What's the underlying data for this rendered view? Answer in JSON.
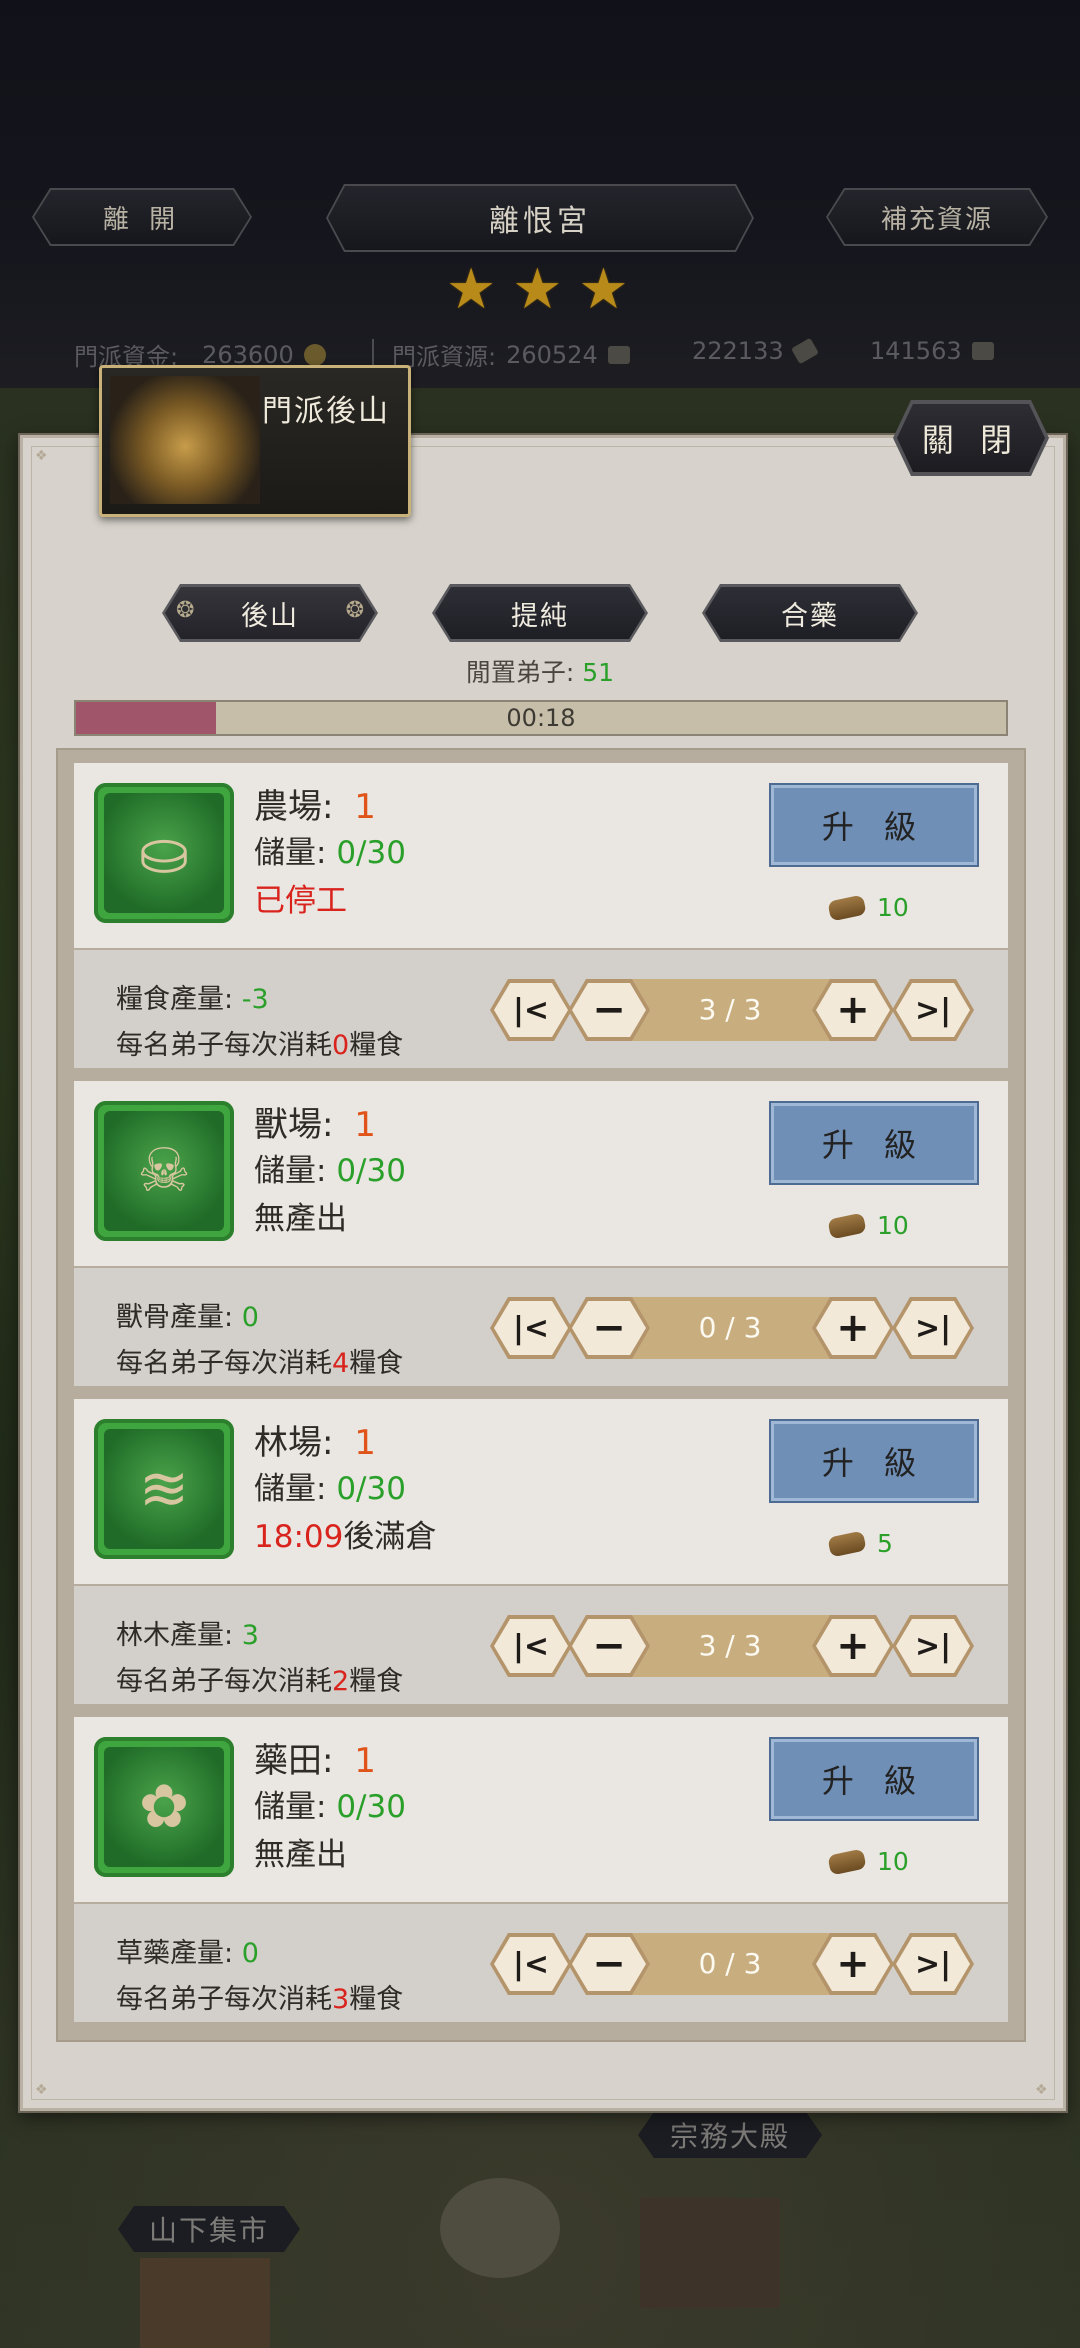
{
  "topbar": {
    "leave_label": "離 開",
    "sect_name": "離恨宮",
    "refill_label": "補充資源",
    "stars": [
      "★",
      "★",
      "★"
    ],
    "funds_label": "門派資金:",
    "funds_value": "263600",
    "resources_label": "門派資源:",
    "resources_value": "260524",
    "res2_value": "222133",
    "res3_value": "141563"
  },
  "panel": {
    "title": "門派後山",
    "close_label": "關 閉",
    "tabs": [
      {
        "label": "後山",
        "active": true
      },
      {
        "label": "提純",
        "active": false
      },
      {
        "label": "合藥",
        "active": false
      }
    ],
    "idle_label": "閒置弟子:",
    "idle_value": "51",
    "timer": "00:18",
    "timer_progress": 0.15,
    "buildings": [
      {
        "name": "農場:",
        "level": "1",
        "storage_label": "儲量:",
        "storage_value": "0/30",
        "status": "已停工",
        "status_time": "",
        "status_suffix": "",
        "upgrade_label": "升 級",
        "cost": "10",
        "prod_label": "糧食產量:",
        "prod_value": "-3",
        "consume_prefix": "每名弟子每次消耗",
        "consume_value": "0",
        "consume_suffix": "糧食",
        "workers": "3 / 3",
        "icon": "grain-sacks-icon"
      },
      {
        "name": "獸場:",
        "level": "1",
        "storage_label": "儲量:",
        "storage_value": "0/30",
        "status": "無產出",
        "status_time": "",
        "status_suffix": "",
        "upgrade_label": "升 級",
        "cost": "10",
        "prod_label": "獸骨產量:",
        "prod_value": "0",
        "consume_prefix": "每名弟子每次消耗",
        "consume_value": "4",
        "consume_suffix": "糧食",
        "workers": "0 / 3",
        "icon": "beast-skull-icon"
      },
      {
        "name": "林場:",
        "level": "1",
        "storage_label": "儲量:",
        "storage_value": "0/30",
        "status": "",
        "status_time": "18:09",
        "status_suffix": "後滿倉",
        "upgrade_label": "升 級",
        "cost": "5",
        "prod_label": "林木產量:",
        "prod_value": "3",
        "consume_prefix": "每名弟子每次消耗",
        "consume_value": "2",
        "consume_suffix": "糧食",
        "workers": "3 / 3",
        "icon": "log-pile-icon"
      },
      {
        "name": "藥田:",
        "level": "1",
        "storage_label": "儲量:",
        "storage_value": "0/30",
        "status": "無產出",
        "status_time": "",
        "status_suffix": "",
        "upgrade_label": "升 級",
        "cost": "10",
        "prod_label": "草藥產量:",
        "prod_value": "0",
        "consume_prefix": "每名弟子每次消耗",
        "consume_value": "3",
        "consume_suffix": "糧食",
        "workers": "0 / 3",
        "icon": "herb-bowl-icon"
      }
    ]
  },
  "world": {
    "hall_label": "宗務大殿",
    "market_label": "山下集市"
  },
  "stepper_glyphs": {
    "first": "|<",
    "minus": "−",
    "plus": "+",
    "last": ">|"
  },
  "colors": {
    "accent_green": "#2aa02a",
    "warn_red": "#d9231d",
    "level_orange": "#e0541a",
    "upgrade_blue": "#6f8fb7"
  }
}
